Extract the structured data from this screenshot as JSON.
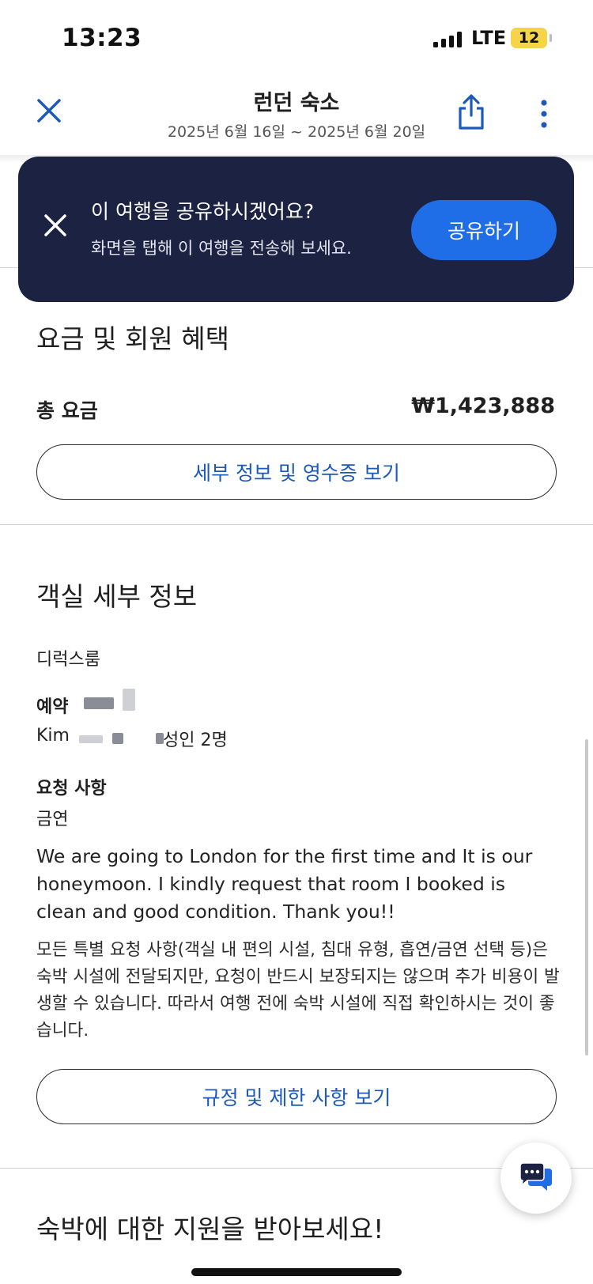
{
  "status_bar": {
    "time": "13:23",
    "network": "LTE",
    "battery": "12"
  },
  "header": {
    "title": "런던 숙소",
    "dates": "2025년 6월 16일 ~ 2025년 6월 20일",
    "icons": [
      "close-icon",
      "share-icon",
      "more-vertical-icon"
    ],
    "accent_color": "#1d59b8"
  },
  "share_banner": {
    "title": "이 여행을 공유하시겠어요?",
    "text": "화면을 탭해 이 여행을 전송해 보세요.",
    "button_label": "공유하기",
    "background_color": "#1b2242",
    "button_color": "#1f6ee8"
  },
  "pricing": {
    "title": "요금 및 회원 혜택",
    "total_label": "총 요금",
    "total_value": "₩1,423,888",
    "details_button": "세부 정보 및 영수증 보기"
  },
  "room": {
    "title": "객실 세부 정보",
    "room_type": "디럭스룸",
    "reservation_label": "예약",
    "guest_name": "Kim",
    "guests": "성인 2명",
    "requests_label": "요청 사항",
    "smoking": "금연",
    "request_text": "We are going to London for the first time and It is our honeymoon. I kindly request that room I booked is clean and good condition. Thank you!!",
    "notice": "모든 특별 요청 사항(객실 내 편의 시설, 침대 유형, 흡연/금연 선택 등)은 숙박 시설에 전달되지만, 요청이 반드시 보장되지는 않으며 추가 비용이 발생할 수 있습니다. 따라서 여행 전에 숙박 시설에 직접 확인하시는 것이 좋습니다.",
    "rules_button": "규정 및 제한 사항 보기"
  },
  "support": {
    "title": "숙박에 대한 지원을 받아보세요!",
    "chat_icon": "chat-bubbles-icon"
  }
}
